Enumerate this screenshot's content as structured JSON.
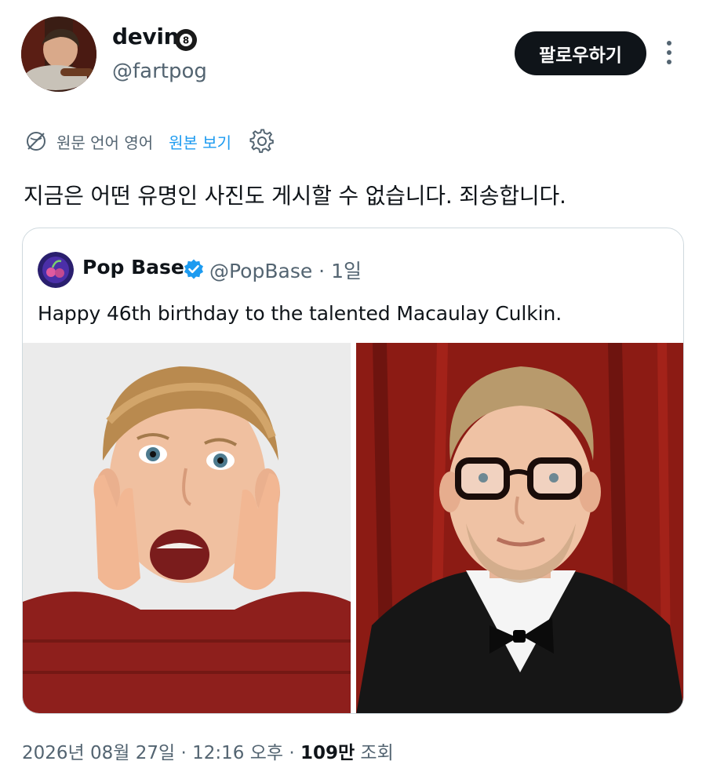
{
  "author": {
    "display_name": "devin",
    "badge_icon": "eight-ball-icon",
    "handle": "@fartpog"
  },
  "actions": {
    "follow_label": "팔로우하기",
    "more_icon": "more-vertical-icon"
  },
  "translation": {
    "icon": "translate-globe-icon",
    "label": "원문 언어 영어",
    "show_original_label": "원본 보기",
    "settings_icon": "gear-icon"
  },
  "tweet": {
    "text": "지금은 어떤 유명인 사진도 게시할 수 없습니다. 죄송합니다."
  },
  "quote": {
    "name": "Pop Base",
    "verified_icon": "verified-badge-icon",
    "meta": "@PopBase · 1일",
    "text": "Happy 46th birthday to the talented Macaulay Culkin.",
    "photos": [
      "photo-left",
      "photo-right"
    ]
  },
  "footer": {
    "timestamp": "2026년 08월 27일 · 12:16 오후 · ",
    "views_count": "109만",
    "views_label": " 조회"
  },
  "colors": {
    "text_primary": "#0f1419",
    "text_secondary": "#536471",
    "link": "#1d9bf0",
    "border": "#cfd9de",
    "button_bg": "#0f1419"
  }
}
